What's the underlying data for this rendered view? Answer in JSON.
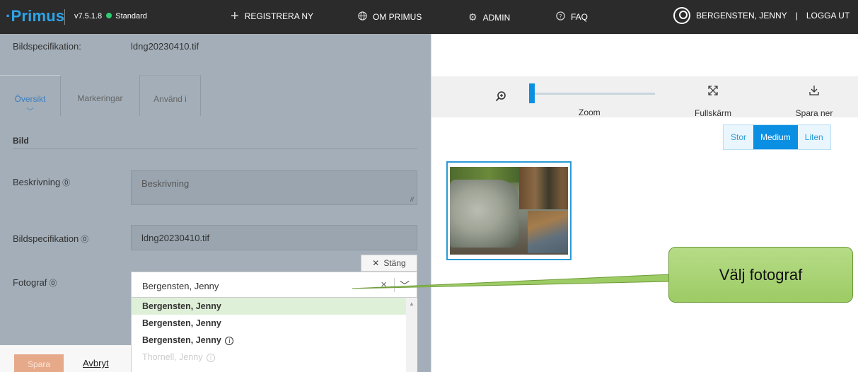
{
  "topbar": {
    "logo": "·Primus",
    "version": "v7.5.1.8",
    "edition": "Standard",
    "nav": [
      {
        "icon": "plus-icon",
        "label": "REGISTRERA NY"
      },
      {
        "icon": "globe-icon",
        "label": "OM PRIMUS"
      },
      {
        "icon": "gear-icon",
        "label": "ADMIN"
      },
      {
        "icon": "help-circle-icon",
        "label": "FAQ"
      }
    ],
    "user": "BERGENSTEN, JENNY",
    "logout": "LOGGA UT"
  },
  "left": {
    "spec_label": "Bildspecifikation:",
    "spec_value": "ldng20230410.tif",
    "tabs": [
      "Översikt",
      "Markeringar",
      "Använd i"
    ],
    "section_title": "Bild",
    "fields": {
      "description_label": "Beskrivning",
      "description_placeholder": "Beskrivning",
      "imagespec_label": "Bildspecifikation",
      "imagespec_value": "ldng20230410.tif",
      "photographer_label": "Fotograf"
    },
    "close_button": "Stäng",
    "photographer_value": "Bergensten, Jenny",
    "dropdown_options": [
      "Bergensten, Jenny",
      "Bergensten, Jenny",
      "Bergensten, Jenny",
      "Thornell, Jenny"
    ],
    "save": "Spara",
    "cancel": "Avbryt"
  },
  "right": {
    "zoom_label": "Zoom",
    "fullscreen_label": "Fullskärm",
    "download_label": "Spara ner",
    "sizes": [
      "Stor",
      "Medium",
      "Liten"
    ],
    "selected_size": "Medium"
  },
  "callout": {
    "text": "Välj fotograf"
  },
  "colors": {
    "accent": "#0a8fe3",
    "logo": "#2fa4e7",
    "topbar": "#2b2b2b",
    "overlay": "#a3aeb8",
    "callout": "#9dcb64"
  }
}
